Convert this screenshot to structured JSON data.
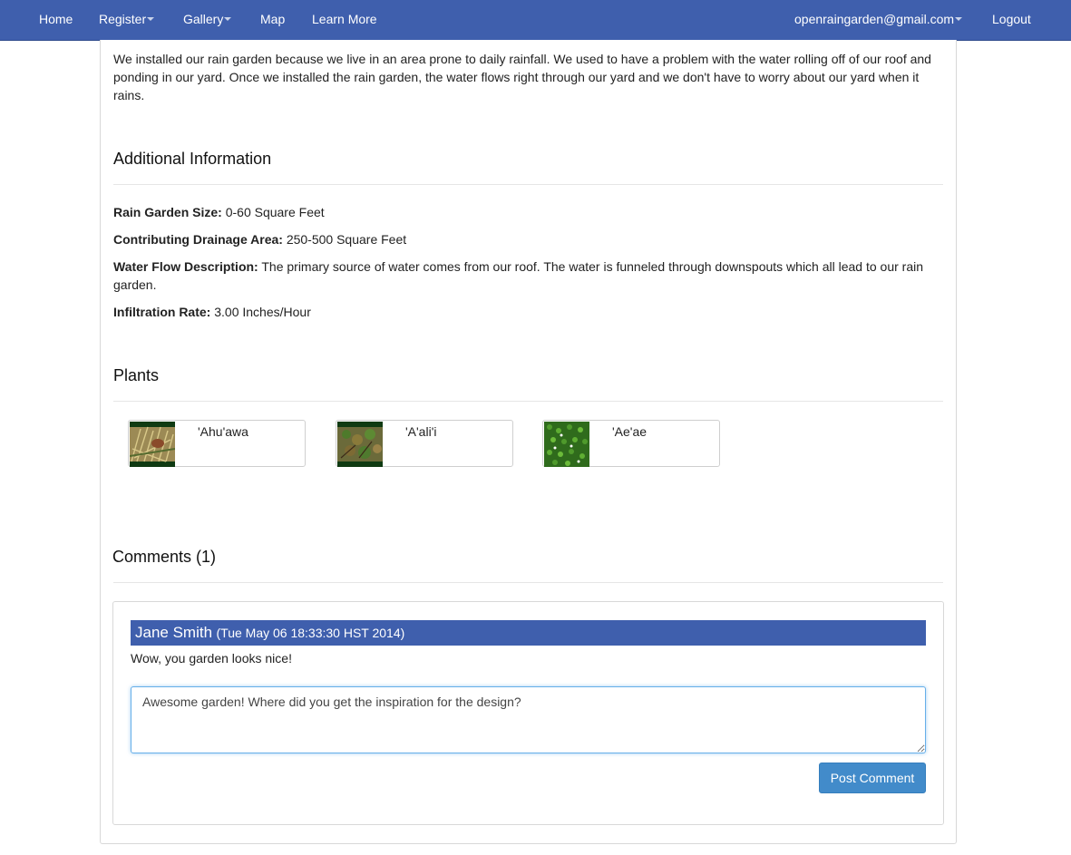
{
  "nav": {
    "home": "Home",
    "register": "Register",
    "gallery": "Gallery",
    "map": "Map",
    "learn_more": "Learn More",
    "account": "openraingarden@gmail.com",
    "logout": "Logout"
  },
  "description": "We installed our rain garden because we live in an area prone to daily rainfall. We used to have a problem with the water rolling off of our roof and ponding in our yard. Once we installed the rain garden, the water flows right through our yard and we don't have to worry about our yard when it rains.",
  "additional_info": {
    "title": "Additional Information",
    "size_label": "Rain Garden Size:",
    "size_value": "0-60 Square Feet",
    "drainage_label": "Contributing Drainage Area:",
    "drainage_value": "250-500 Square Feet",
    "flow_label": "Water Flow Description:",
    "flow_value": "The primary source of water comes from our roof. The water is funneled through downspouts which all lead to our rain garden.",
    "infiltration_label": "Infiltration Rate:",
    "infiltration_value": "3.00 Inches/Hour"
  },
  "plants": {
    "title": "Plants",
    "items": [
      {
        "name": "'Ahu'awa",
        "icon": "grass-plant-icon"
      },
      {
        "name": "'A'ali'i",
        "icon": "shrub-plant-icon"
      },
      {
        "name": "'Ae'ae",
        "icon": "groundcover-plant-icon"
      }
    ]
  },
  "comments": {
    "title": "Comments",
    "count": "(1)",
    "items": [
      {
        "author": "Jane Smith",
        "date": "(Tue May 06 18:33:30 HST 2014)",
        "text": "Wow, you garden looks nice!"
      }
    ],
    "input_value": "Awesome garden! Where did you get the inspiration for the design?",
    "post_label": "Post Comment"
  },
  "colors": {
    "navbar": "#3f5fad",
    "comment_header": "#3f5fad",
    "button": "#428bca"
  }
}
